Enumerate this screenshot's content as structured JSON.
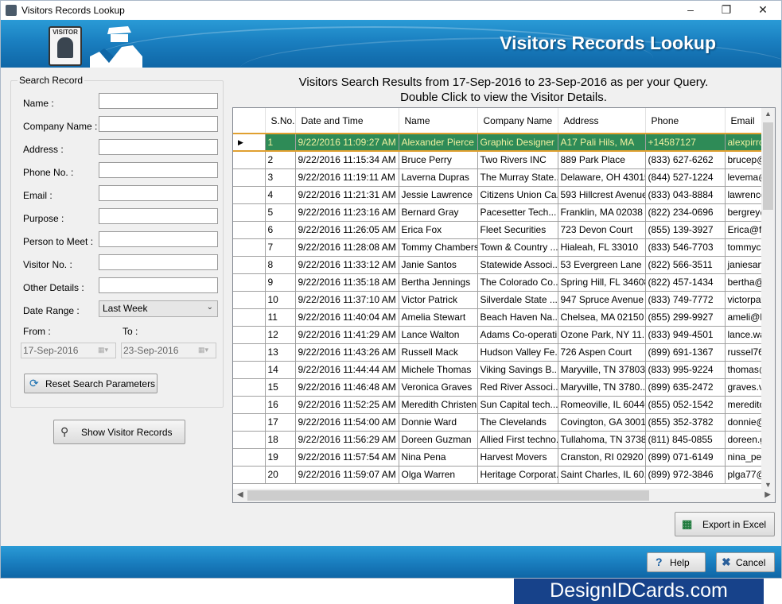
{
  "window": {
    "title": "Visitors Records Lookup"
  },
  "banner": {
    "title": "Visitors Records Lookup",
    "badge_text": "VISITOR"
  },
  "search": {
    "legend": "Search Record",
    "fields": [
      {
        "label": "Name :",
        "value": ""
      },
      {
        "label": "Company Name :",
        "value": ""
      },
      {
        "label": "Address :",
        "value": ""
      },
      {
        "label": "Phone No. :",
        "value": ""
      },
      {
        "label": "Email :",
        "value": ""
      },
      {
        "label": "Purpose :",
        "value": ""
      },
      {
        "label": "Person to Meet :",
        "value": ""
      },
      {
        "label": "Visitor No. :",
        "value": ""
      },
      {
        "label": "Other Details :",
        "value": ""
      }
    ],
    "date_range_label": "Date Range :",
    "date_range_value": "Last Week",
    "from_label": "From :",
    "to_label": "To :",
    "from_date": "17-Sep-2016",
    "to_date": "23-Sep-2016",
    "reset_label": "Reset Search Parameters",
    "show_label": "Show Visitor Records"
  },
  "results": {
    "line1": "Visitors Search Results from 17-Sep-2016 to 23-Sep-2016 as per your Query.",
    "line2": "Double Click to view the Visitor Details.",
    "columns": [
      "S.No.",
      "Date and Time",
      "Name",
      "Company Name",
      "Address",
      "Phone",
      "Email"
    ],
    "rows": [
      [
        "1",
        "9/22/2016 11:09:27 AM",
        "Alexander Pierce",
        "Graphic Designer",
        "A17 Pali Hils, MA",
        "+14587127",
        "alexpirrce"
      ],
      [
        "2",
        "9/22/2016 11:15:34 AM",
        "Bruce Perry",
        "Two Rivers INC",
        "889 Park Place",
        "(833) 627-6262",
        "brucep@"
      ],
      [
        "3",
        "9/22/2016 11:19:11 AM",
        "Laverna Dupras",
        "The Murray State...",
        "Delaware, OH 43015",
        "(844) 527-1224",
        "levema@"
      ],
      [
        "4",
        "9/22/2016 11:21:31 AM",
        "Jessie Lawrence",
        "Citizens Union Ca...",
        "593 Hillcrest Avenue",
        "(833) 043-8884",
        "lawrence"
      ],
      [
        "5",
        "9/22/2016 11:23:16 AM",
        "Bernard Gray",
        "Pacesetter Tech...",
        "Franklin, MA 02038",
        "(822) 234-0696",
        "bergrey@"
      ],
      [
        "6",
        "9/22/2016 11:26:05 AM",
        "Erica Fox",
        "Fleet Securities",
        "723 Devon Court",
        "(855) 139-3927",
        "Erica@fle"
      ],
      [
        "7",
        "9/22/2016 11:28:08 AM",
        "Tommy Chambers",
        "Town & Country ...",
        "Hialeah, FL 33010",
        "(833) 546-7703",
        "tommycha"
      ],
      [
        "8",
        "9/22/2016 11:33:12 AM",
        "Janie Santos",
        "Statewide Associ...",
        "53 Evergreen Lane",
        "(822) 566-3511",
        "janiesan@"
      ],
      [
        "9",
        "9/22/2016 11:35:18 AM",
        "Bertha Jennings",
        "The Colorado Co...",
        "Spring Hill, FL 34608",
        "(822) 457-1434",
        "bertha@c"
      ],
      [
        "10",
        "9/22/2016 11:37:10 AM",
        "Victor Patrick",
        "Silverdale State ...",
        "947 Spruce Avenue",
        "(833) 749-7772",
        "victorpat("
      ],
      [
        "11",
        "9/22/2016 11:40:04 AM",
        "Amelia Stewart",
        "Beach Haven Na...",
        "Chelsea, MA 02150",
        "(855) 299-9927",
        "ameli@bh"
      ],
      [
        "12",
        "9/22/2016 11:41:29 AM",
        "Lance Walton",
        "Adams Co-operati...",
        "Ozone Park, NY 11...",
        "(833) 949-4501",
        "lance.wal"
      ],
      [
        "13",
        "9/22/2016 11:43:26 AM",
        "Russell Mack",
        "Hudson Valley Fe...",
        "726 Aspen Court",
        "(899) 691-1367",
        "russel76@"
      ],
      [
        "14",
        "9/22/2016 11:44:44 AM",
        "Michele Thomas",
        "Viking Savings B...",
        "Maryville, TN 37803",
        "(833) 995-9224",
        "thomas@"
      ],
      [
        "15",
        "9/22/2016 11:46:48 AM",
        "Veronica Graves",
        "Red River Associ...",
        "Maryville, TN 3780...",
        "(899) 635-2472",
        "graves.ve"
      ],
      [
        "16",
        "9/22/2016 11:52:25 AM",
        "Meredith Christen...",
        "Sun Capital tech...",
        "Romeoville, IL 60446",
        "(855) 052-1542",
        "mereditch"
      ],
      [
        "17",
        "9/22/2016 11:54:00 AM",
        "Donnie Ward",
        "The Clevelands",
        "Covington, GA 30014",
        "(855) 352-3782",
        "donnie@"
      ],
      [
        "18",
        "9/22/2016 11:56:29 AM",
        "Doreen Guzman",
        "Allied First techno...",
        "Tullahoma, TN 37388",
        "(811) 845-0855",
        "doreen.gu"
      ],
      [
        "19",
        "9/22/2016 11:57:54 AM",
        "Nina Pena",
        "Harvest Movers",
        "Cranston, RI 02920",
        "(899) 071-6149",
        "nina_pen"
      ],
      [
        "20",
        "9/22/2016 11:59:07 AM",
        "Olga Warren",
        "Heritage Corporat...",
        "Saint Charles, IL 60...",
        "(899) 972-3846",
        "plga77@"
      ]
    ]
  },
  "actions": {
    "export_label": "Export in Excel",
    "help_label": "Help",
    "cancel_label": "Cancel"
  },
  "brand": {
    "text": "DesignIDCards.com"
  },
  "colors": {
    "banner": "#1a7fc0",
    "selected_row": "#2e8b57",
    "brand_bg": "#17428a"
  }
}
